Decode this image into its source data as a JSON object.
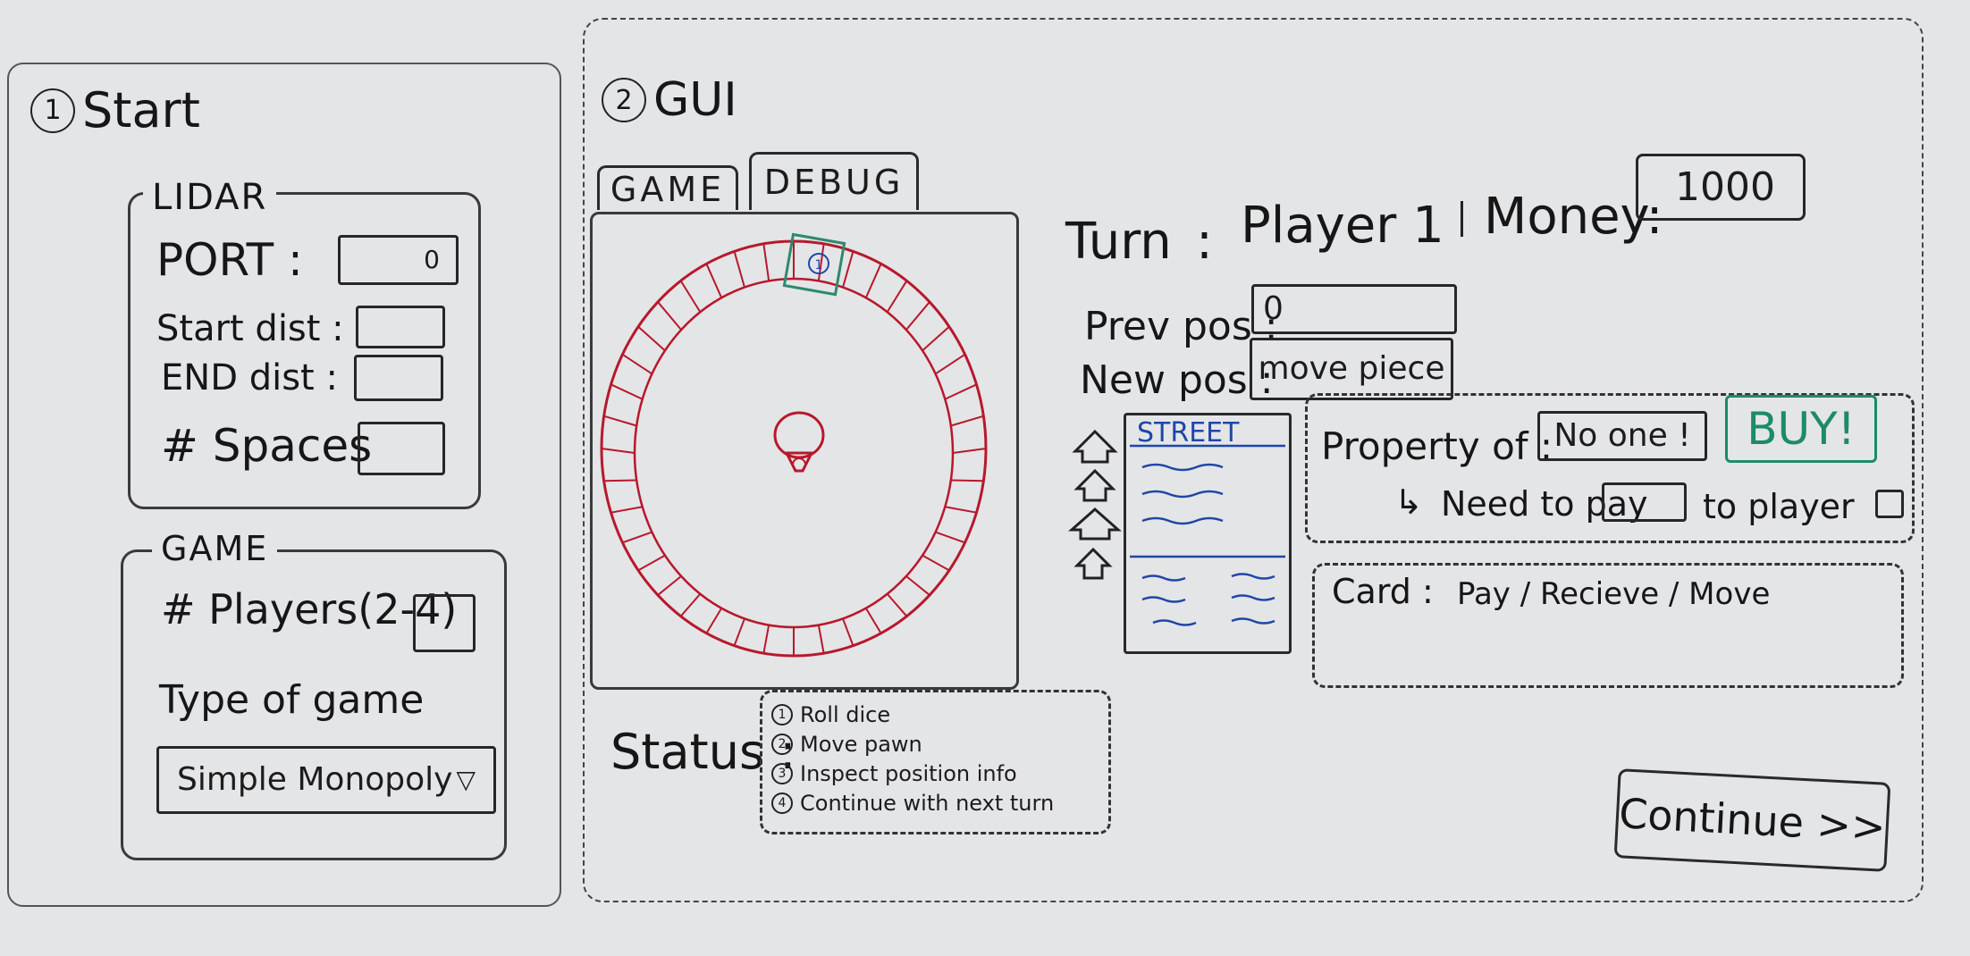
{
  "start": {
    "number": "1",
    "title": "Start",
    "lidar": {
      "legend": "LIDAR",
      "port_label": "PORT :",
      "port_value": "0",
      "start_dist_label": "Start dist :",
      "end_dist_label": "END dist :",
      "spaces_label": "# Spaces"
    },
    "game": {
      "legend": "GAME",
      "players_label": "# Players(2-4)",
      "type_label": "Type of game",
      "type_selected": "Simple Monopoly"
    }
  },
  "gui": {
    "number": "2",
    "title": "GUI",
    "tabs": [
      "GAME",
      "DEBUG"
    ],
    "board": {
      "spaces": 40,
      "player_token": "1"
    },
    "status": {
      "label": "Status :",
      "steps": [
        {
          "n": "1",
          "text": "Roll dice"
        },
        {
          "n": "2",
          "text": "Move pawn"
        },
        {
          "n": "3",
          "text": "Inspect position info"
        },
        {
          "n": "4",
          "text": "Continue with next turn"
        }
      ]
    },
    "turn_label": "Turn",
    "turn_sep": ":",
    "turn_player": "Player 1",
    "money_label": "Money:",
    "money_value": "1000",
    "prev_pos_label": "Prev pos :",
    "prev_pos_value": "0",
    "new_pos_label": "New pos :",
    "new_pos_value": "move piece",
    "street_card_title": "STREET",
    "property_label": "Property of :",
    "property_value": "No one !",
    "buy_label": "BUY!",
    "need_to_pay_label": "Need to pay",
    "to_player_label": "to player",
    "card_label": "Card :",
    "card_value": "Pay / Recieve / Move",
    "continue_label": "Continue >>"
  },
  "colors": {
    "board_red": "#b8182c",
    "token_green": "#2d8a6b",
    "street_blue": "#1f46a8"
  }
}
